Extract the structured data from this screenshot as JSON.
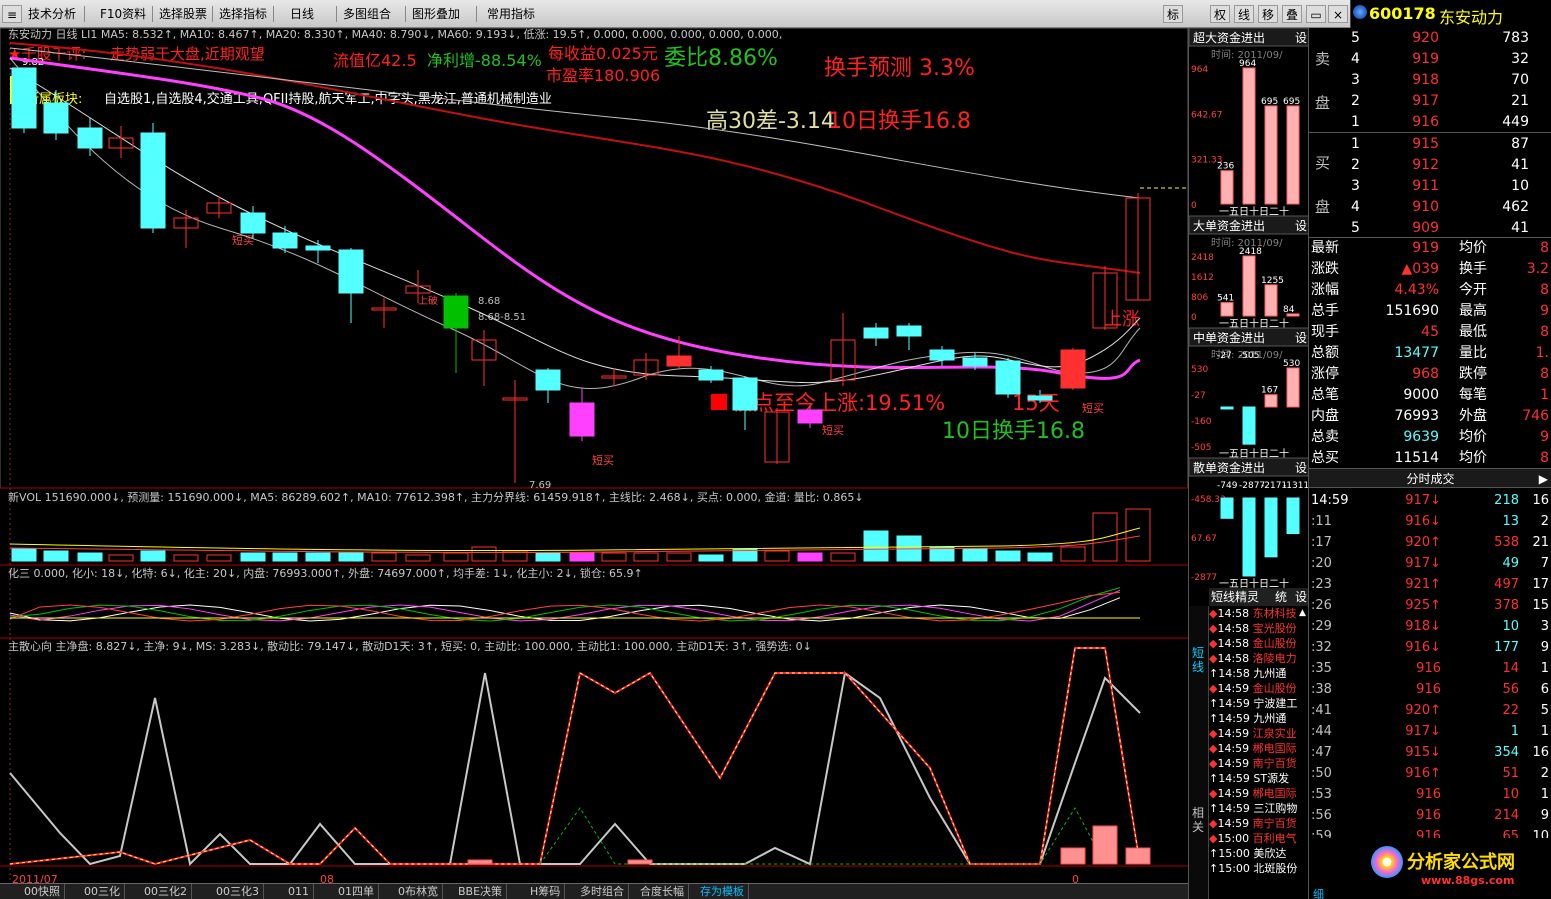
{
  "toolbar": {
    "items": [
      "技术分析",
      "F10资料",
      "选择股票",
      "选择指标",
      "日线",
      "多图组合",
      "图形叠加",
      "常用指标"
    ],
    "right_buttons": [
      "标",
      "权",
      "线",
      "移",
      "叠"
    ]
  },
  "logo": {
    "code": "600178",
    "name": "东安动力"
  },
  "header": {
    "line1": "东安动力 日线 LI1 MA5: 8.532↑, MA10: 8.467↑, MA20: 8.330↑, MA40: 8.790↓, MA60: 9.193↓, 低涨: 19.5↑, 0.000, 0.000, 0.000, 0.000, 0.000,",
    "comment_label": "★千股千评:",
    "comment": "走势弱于大盘,近期观望",
    "sector_label": "所属板块:",
    "sector": "自选股1,自选股4,交通工具,QFII持股,航天军工,中字头,黑龙江,普通机械制造业",
    "price_tag": "9.82"
  },
  "overlays": {
    "float_cap": "流值亿42.5",
    "net_profit": "净利增-88.54%",
    "eps": "每收益0.025元",
    "pe": "市盈率180.906",
    "weibi": "委比8.86%",
    "turn_forecast": "换手预测 3.3%",
    "high30": "高30差-3.14",
    "turn10_top": "10日换手16.8",
    "low_rise": "低点至今上涨:19.51%",
    "days": "15天",
    "turn10_bottom": "10日换手16.8",
    "shangzhang": "上涨",
    "buy_signal": "短买",
    "lower_low": "7.69",
    "label_868": "8.68",
    "label_851": "8.68-8.51",
    "up_break": "上破"
  },
  "vol_header": "新VOL 151690.000↓, 预测量: 151690.000↓, MA5: 86289.602↑, MA10: 77612.398↑, 主力分界线: 61459.918↑, 主线比: 2.468↓, 买点: 0.000, 金道: 量比: 0.865↓",
  "ind2_header": "化三 0.000, 化小: 18↓, 化特: 6↓, 化主: 20↓, 内盘: 76993.000↑, 外盘: 74697.000↑, 均手差: 1↓, 化主小: 2↓, 锁仓: 65.9↑",
  "ind3_header": "主散心向 主净盘: 8.827↓, 主净: 9↓, MS: 3.283↓, 散动比: 79.147↓, 散动D1天: 3↑, 短买: 0, 主动比: 100.000, 主动比1: 100.000, 主动D1天: 3↑, 强势选: 0↓",
  "axis": {
    "left_date": "2011/07",
    "mid_date": "08",
    "right_date": "0"
  },
  "flow_panels": [
    {
      "title": "超大资金进出",
      "time": "时间: 2011/09/",
      "yticks": [
        "964",
        "642.67",
        "321.33",
        "0"
      ],
      "values": [
        236,
        964,
        695,
        695
      ],
      "bar_labels": [
        "236",
        "964",
        "695",
        "695"
      ],
      "xlabels": "一五日十日二十"
    },
    {
      "title": "大单资金进出",
      "time": "时间: 2011/09/",
      "yticks": [
        "2418",
        "1612",
        "806",
        "0"
      ],
      "values": [
        541,
        2418,
        1255,
        84
      ],
      "bar_labels": [
        "541",
        "2418",
        "1255",
        "84"
      ],
      "xlabels": "一五日十日二十"
    },
    {
      "title": "中单资金进出",
      "time": "时间: 2011/09/",
      "yticks": [
        "530",
        "-27",
        "-160",
        "-505"
      ],
      "values": [
        -27,
        -505,
        167,
        530
      ],
      "bar_labels": [
        "-27",
        "-505",
        "167",
        "530"
      ],
      "xlabels": "一五日十日二十"
    },
    {
      "title": "散单资金进出",
      "time": "",
      "yticks": [
        "-458.33",
        "67.67",
        "-2877"
      ],
      "values": [
        -749,
        -2877,
        -2171,
        -1311
      ],
      "bar_labels": [
        "-749",
        "-2877",
        "-2171",
        "-1311"
      ],
      "xlabels": "一五日十日二十"
    }
  ],
  "flow_set": "设",
  "shortlist": {
    "title": "短线精灵",
    "tabs": [
      "统",
      "设"
    ],
    "side_labels": [
      "短线",
      "相关"
    ],
    "rows": [
      {
        "t": "14:58",
        "n": "东材科技",
        "up": false
      },
      {
        "t": "14:58",
        "n": "宝光股份",
        "up": false
      },
      {
        "t": "14:58",
        "n": "金山股份",
        "up": false
      },
      {
        "t": "14:58",
        "n": "洛陵电力",
        "up": false
      },
      {
        "t": "14:58",
        "n": "九州通",
        "up": true
      },
      {
        "t": "14:59",
        "n": "金山股份",
        "up": false
      },
      {
        "t": "14:59",
        "n": "宁波建工",
        "up": true
      },
      {
        "t": "14:59",
        "n": "九州通",
        "up": true
      },
      {
        "t": "14:59",
        "n": "江泉实业",
        "up": false
      },
      {
        "t": "14:59",
        "n": "郴电国际",
        "up": false
      },
      {
        "t": "14:59",
        "n": "南宁百货",
        "up": false
      },
      {
        "t": "14:59",
        "n": "ST源发",
        "up": true
      },
      {
        "t": "14:59",
        "n": "郴电国际",
        "up": false
      },
      {
        "t": "14:59",
        "n": "三江购物",
        "up": true
      },
      {
        "t": "14:59",
        "n": "南宁百货",
        "up": false
      },
      {
        "t": "15:00",
        "n": "百利电气",
        "up": false
      },
      {
        "t": "15:00",
        "n": "美欣达",
        "up": true
      },
      {
        "t": "15:00",
        "n": "北斑股份",
        "up": true
      }
    ]
  },
  "quote": {
    "sell_label": [
      "卖",
      "盘"
    ],
    "buy_label": [
      "买",
      "盘"
    ],
    "asks": [
      {
        "lvl": "5",
        "price": "920",
        "vol": "783"
      },
      {
        "lvl": "4",
        "price": "919",
        "vol": "32"
      },
      {
        "lvl": "3",
        "price": "918",
        "vol": "70"
      },
      {
        "lvl": "2",
        "price": "917",
        "vol": "21"
      },
      {
        "lvl": "1",
        "price": "916",
        "vol": "449"
      }
    ],
    "bids": [
      {
        "lvl": "1",
        "price": "915",
        "vol": "87"
      },
      {
        "lvl": "2",
        "price": "912",
        "vol": "41"
      },
      {
        "lvl": "3",
        "price": "911",
        "vol": "10"
      },
      {
        "lvl": "4",
        "price": "910",
        "vol": "462"
      },
      {
        "lvl": "5",
        "price": "909",
        "vol": "41"
      }
    ],
    "stats": [
      {
        "k": "最新",
        "v": "919",
        "k2": "均价",
        "v2": "8"
      },
      {
        "k": "涨跌",
        "v": "▲039",
        "k2": "换手",
        "v2": "3.2"
      },
      {
        "k": "涨幅",
        "v": "4.43%",
        "k2": "今开",
        "v2": "8"
      },
      {
        "k": "总手",
        "v": "151690",
        "k2": "最高",
        "v2": "9"
      },
      {
        "k": "现手",
        "v": "45",
        "k2": "最低",
        "v2": "8"
      },
      {
        "k": "总额",
        "v": "13477",
        "k2": "量比",
        "v2": "1."
      },
      {
        "k": "涨停",
        "v": "968",
        "k2": "跌停",
        "v2": "8"
      },
      {
        "k": "总笔",
        "v": "9000",
        "k2": "每笔",
        "v2": "1"
      },
      {
        "k": "内盘",
        "v": "76993",
        "k2": "外盘",
        "v2": "746"
      },
      {
        "k": "总卖",
        "v": "9639",
        "k2": "均价",
        "v2": "9"
      },
      {
        "k": "总买",
        "v": "11514",
        "k2": "均价",
        "v2": "8"
      }
    ],
    "tick_title": "分时成交",
    "ticks": [
      {
        "t": "14:59",
        "p": "917",
        "d": "↓",
        "v": "218",
        "x": "16"
      },
      {
        "t": ":11",
        "p": "916",
        "d": "↓",
        "v": "13",
        "x": "2"
      },
      {
        "t": ":17",
        "p": "920",
        "d": "↑",
        "v": "538",
        "x": "21"
      },
      {
        "t": ":20",
        "p": "917",
        "d": "↓",
        "v": "49",
        "x": "7"
      },
      {
        "t": ":23",
        "p": "921",
        "d": "↑",
        "v": "497",
        "x": "17"
      },
      {
        "t": ":26",
        "p": "925",
        "d": "↑",
        "v": "378",
        "x": "15"
      },
      {
        "t": ":29",
        "p": "918",
        "d": "↓",
        "v": "10",
        "x": "3"
      },
      {
        "t": ":32",
        "p": "916",
        "d": "↓",
        "v": "177",
        "x": "9"
      },
      {
        "t": ":35",
        "p": "916",
        "d": "",
        "v": "14",
        "x": "1"
      },
      {
        "t": ":38",
        "p": "916",
        "d": "",
        "v": "56",
        "x": "6"
      },
      {
        "t": ":41",
        "p": "920",
        "d": "↑",
        "v": "22",
        "x": "5"
      },
      {
        "t": ":44",
        "p": "917",
        "d": "↓",
        "v": "1",
        "x": "1"
      },
      {
        "t": ":47",
        "p": "915",
        "d": "↓",
        "v": "354",
        "x": "16"
      },
      {
        "t": ":50",
        "p": "916",
        "d": "↑",
        "v": "51",
        "x": "2"
      },
      {
        "t": ":53",
        "p": "916",
        "d": "",
        "v": "10",
        "x": "1"
      },
      {
        "t": ":56",
        "p": "916",
        "d": "",
        "v": "214",
        "x": "9"
      },
      {
        "t": ":59",
        "p": "916",
        "d": "",
        "v": "65",
        "x": "10"
      },
      {
        "t": "15:00",
        "p": "",
        "d": "",
        "v": "",
        "x": ""
      }
    ],
    "footer_brand": "分析家公式网",
    "footer_url": "www.88gs.com",
    "footer_tab": "细"
  },
  "bottom_tabs": [
    "00快照",
    "00三化",
    "00三化2",
    "00三化3",
    "011",
    "01四单",
    "0布林宽",
    "BBE决策",
    "H筹码",
    "多时组合",
    "合度长幅",
    "存为模板"
  ],
  "colors": {
    "up": "#ff3030",
    "down": "#54ffff",
    "ma_magenta": "#ff40ff",
    "ma_red": "#c01010",
    "green": "#00c000",
    "yellow": "#ffff00"
  }
}
